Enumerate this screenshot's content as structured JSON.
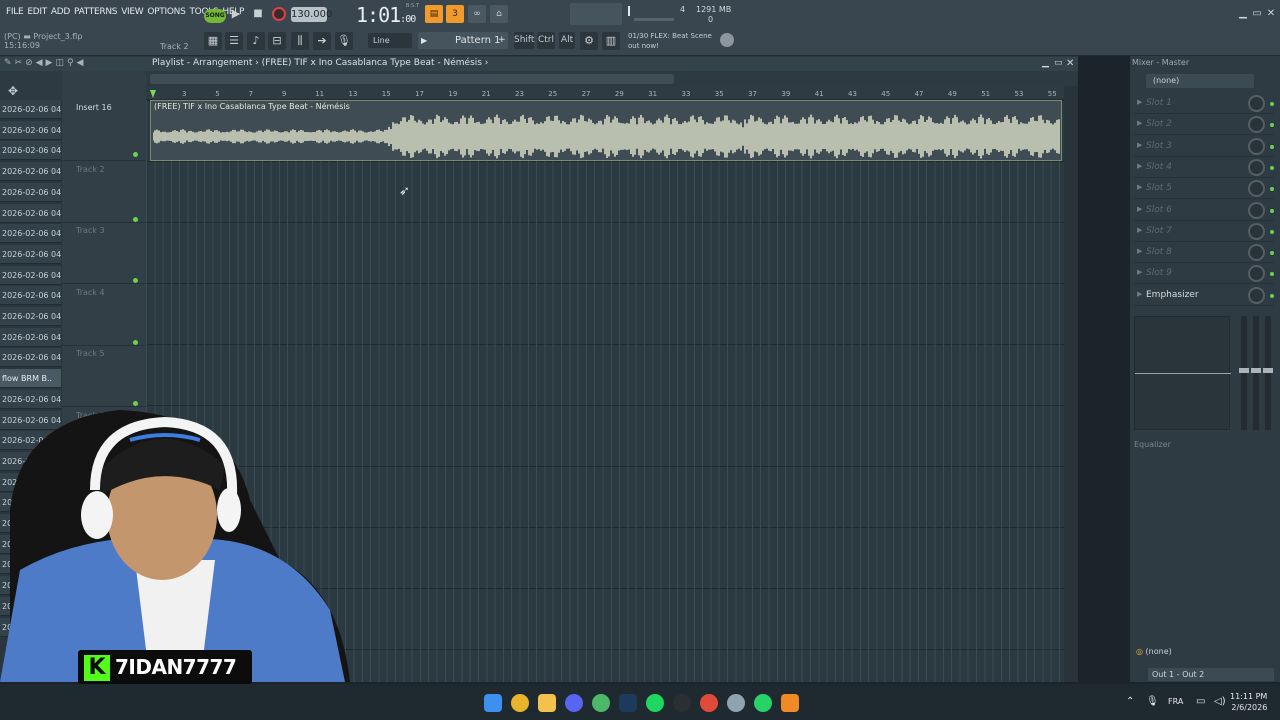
{
  "menu": [
    "FILE",
    "EDIT",
    "ADD",
    "PATTERNS",
    "VIEW",
    "OPTIONS",
    "TOOLS",
    "HELP"
  ],
  "transport": {
    "song_label": "SONG",
    "tempo": "130.000",
    "time": "1:01",
    "time_sub": ":00",
    "bst": "B:S:T"
  },
  "perf": {
    "cpu": "4",
    "ram": "1291 MB",
    "poly": "0"
  },
  "project": {
    "line1": "(PC) ▬ Project_3.flp",
    "line2": "15:16:09",
    "hint": "Track 2"
  },
  "snap": "Line",
  "pattern": "Pattern 1",
  "keys": [
    "Shift",
    "Ctrl",
    "Alt"
  ],
  "news": {
    "line1": "01/30  FLEX: Beat Scene",
    "line2": "out now!"
  },
  "playlist": {
    "title": "Playlist - Arrangement › (FREE) TIF x Ino Casablanca Type Beat - Némésis ›",
    "clip_title": "(FREE) TIF x Ino Casablanca Type Beat - Némésis",
    "bars": [
      "3",
      "5",
      "7",
      "9",
      "11",
      "13",
      "15",
      "17",
      "19",
      "21",
      "23",
      "25",
      "27",
      "29",
      "31",
      "33",
      "35",
      "37",
      "39",
      "41",
      "43",
      "45",
      "47",
      "49",
      "51",
      "53",
      "55"
    ],
    "tracks": [
      "Insert 16",
      "Track 2",
      "Track 3",
      "Track 4",
      "Track 5",
      "Track 6"
    ]
  },
  "pattern_list": [
    "2026-02-06 04-",
    "2026-02-06 04-",
    "2026-02-06 04-",
    "2026-02-06 04-",
    "2026-02-06 04-",
    "2026-02-06 04-",
    "2026-02-06 04-",
    "2026-02-06 04-",
    "2026-02-06 04-",
    "2026-02-06 04-",
    "2026-02-06 04-",
    "2026-02-06 04-",
    "2026-02-06 04-",
    "flow BRM B..",
    "2026-02-06 04-",
    "2026-02-06 04-",
    "2026-02-06 04-",
    "2026-02-06 04-",
    "2026-02-06 04-",
    "2026-02-06 04",
    "2026-02-0",
    "2026-0",
    "2026-",
    "2026-",
    "2026-",
    "2026-"
  ],
  "mixer": {
    "title": "Mixer - Master",
    "preset": "(none)",
    "slots": [
      "Slot 1",
      "Slot 2",
      "Slot 3",
      "Slot 4",
      "Slot 5",
      "Slot 6",
      "Slot 7",
      "Slot 8",
      "Slot 9"
    ],
    "emphasizer": "Emphasizer",
    "equalizer": "Equalizer",
    "bottom_preset": "(none)",
    "output": "Out 1 - Out 2"
  },
  "streamer": {
    "name": "7IDAN7777",
    "logo": "K"
  },
  "taskbar": {
    "lang": "FRA",
    "time": "11:11 PM",
    "date": "2/6/2026"
  },
  "colors": {
    "accent_orange": "#f09a2c",
    "accent_green": "#6ed24b",
    "kick_green": "#53fc18",
    "record_red": "#d64545"
  }
}
